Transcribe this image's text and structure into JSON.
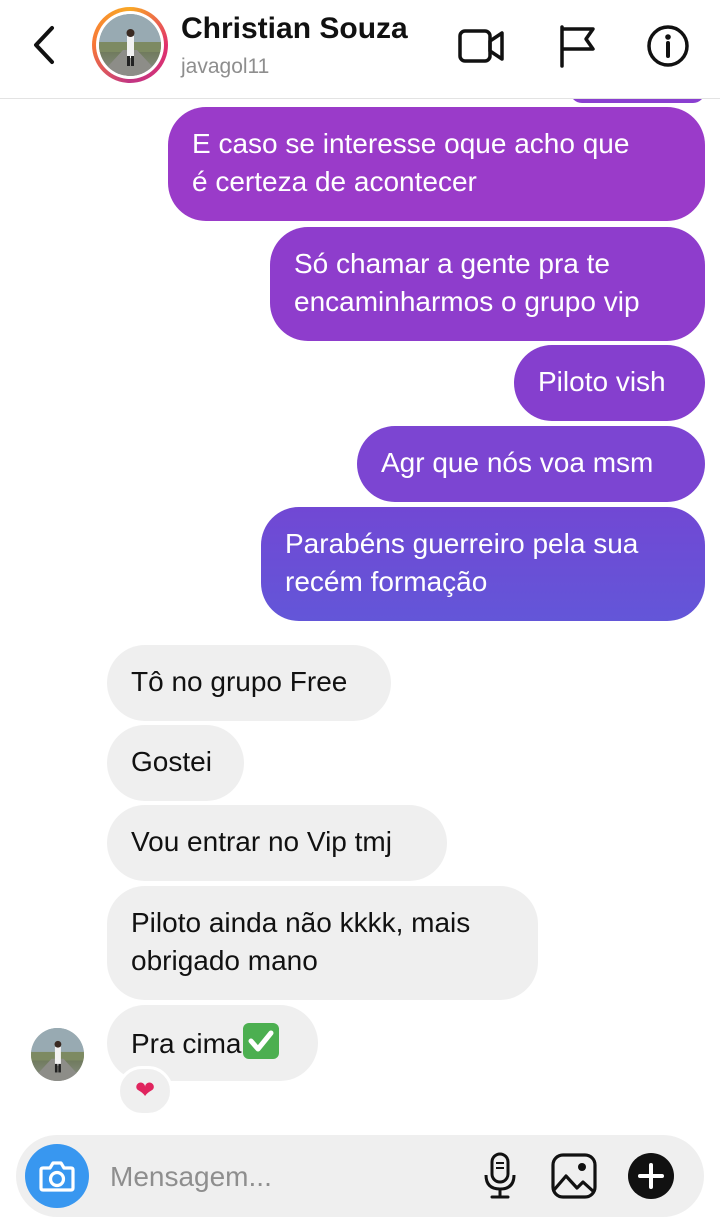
{
  "header": {
    "name": "Christian Souza",
    "username": "javagol11",
    "icons": [
      "back-arrow-icon",
      "video-call-icon",
      "flag-icon",
      "info-icon"
    ]
  },
  "messages": [
    {
      "direction": "out",
      "text_lines": [
        "E caso se interesse oque acho que",
        "é certeza de acontecer"
      ]
    },
    {
      "direction": "out",
      "text_lines": [
        "Só chamar a gente pra te",
        "encaminharmos o grupo vip"
      ]
    },
    {
      "direction": "out",
      "text_lines": [
        "Piloto vish"
      ]
    },
    {
      "direction": "out",
      "text_lines": [
        "Agr que nós voa msm"
      ]
    },
    {
      "direction": "out",
      "text_lines": [
        "Parabéns guerreiro pela sua",
        "recém formação"
      ]
    },
    {
      "direction": "in",
      "text_lines": [
        "Tô no grupo Free"
      ]
    },
    {
      "direction": "in",
      "text_lines": [
        "Gostei"
      ]
    },
    {
      "direction": "in",
      "text_lines": [
        "Vou entrar no Vip tmj"
      ]
    },
    {
      "direction": "in",
      "text_lines": [
        "Piloto ainda não kkkk, mais",
        "obrigado mano"
      ]
    },
    {
      "direction": "in",
      "text_lines": [
        "Pra cima"
      ],
      "emoji": "check-mark-emoji",
      "reaction": "❤"
    }
  ],
  "composer": {
    "placeholder": "Mensagem...",
    "icons": [
      "camera-icon",
      "microphone-icon",
      "gallery-icon",
      "plus-icon"
    ]
  },
  "colors": {
    "bubble_out_top": "#9b3ac8",
    "bubble_out_bottom": "#6356d8",
    "bubble_in": "#efefef",
    "camera_button": "#3897f0",
    "reaction_heart": "#e0245e"
  }
}
